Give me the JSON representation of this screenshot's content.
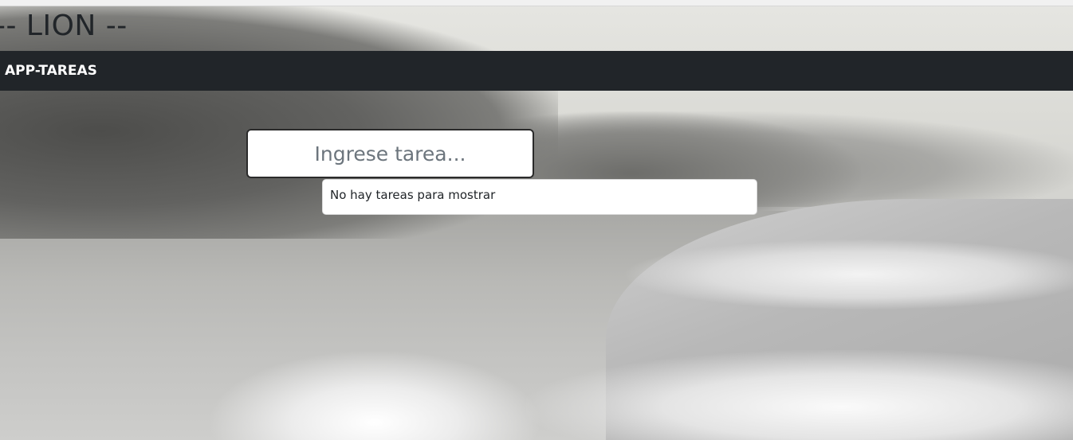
{
  "header": {
    "brand_text": "-- LION --"
  },
  "navbar": {
    "brand_label": "APP-TAREAS",
    "background_color": "#212529"
  },
  "task_form": {
    "input_value": "",
    "input_placeholder": "Ingrese tarea..."
  },
  "task_list": {
    "empty_message": "No hay tareas para mostrar"
  }
}
